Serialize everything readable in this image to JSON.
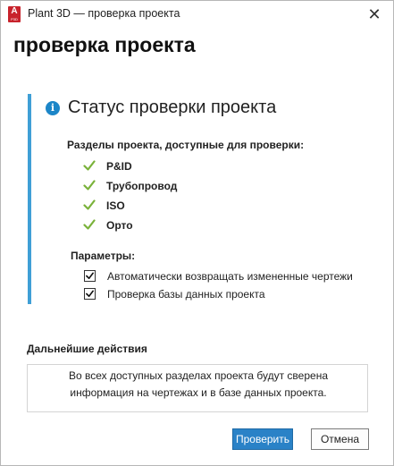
{
  "window": {
    "title": "Plant 3D — проверка проекта",
    "close_symbol": "✕"
  },
  "app_icon": {
    "letter": "A",
    "sub": "P3D",
    "name": "autocad-plant3d-icon"
  },
  "heading": "проверка проекта",
  "status": {
    "title": "Статус проверки проекта",
    "info_icon_glyph": "i",
    "sections_label": "Разделы проекта, доступные для проверки:",
    "sections": [
      {
        "label": "P&ID",
        "checked": true
      },
      {
        "label": "Трубопровод",
        "checked": true
      },
      {
        "label": "ISO",
        "checked": true
      },
      {
        "label": "Орто",
        "checked": true
      }
    ],
    "params_label": "Параметры:",
    "params": [
      {
        "label": "Автоматически возвращать измененные чертежи",
        "checked": true
      },
      {
        "label": "Проверка базы данных проекта",
        "checked": true
      }
    ]
  },
  "actions": {
    "heading": "Дальнейшие действия",
    "line1": "Во всех доступных разделах проекта будут сверена",
    "line2": "информация на чертежах и в базе данных проекта."
  },
  "buttons": {
    "check_label": "Проверить",
    "cancel_label": "Отмена"
  },
  "colors": {
    "accent_bar": "#3f9fd6",
    "info_icon": "#1c86c8",
    "check_green": "#7ab23a",
    "primary_button": "#2a82c7",
    "app_icon_red": "#c8232c"
  }
}
